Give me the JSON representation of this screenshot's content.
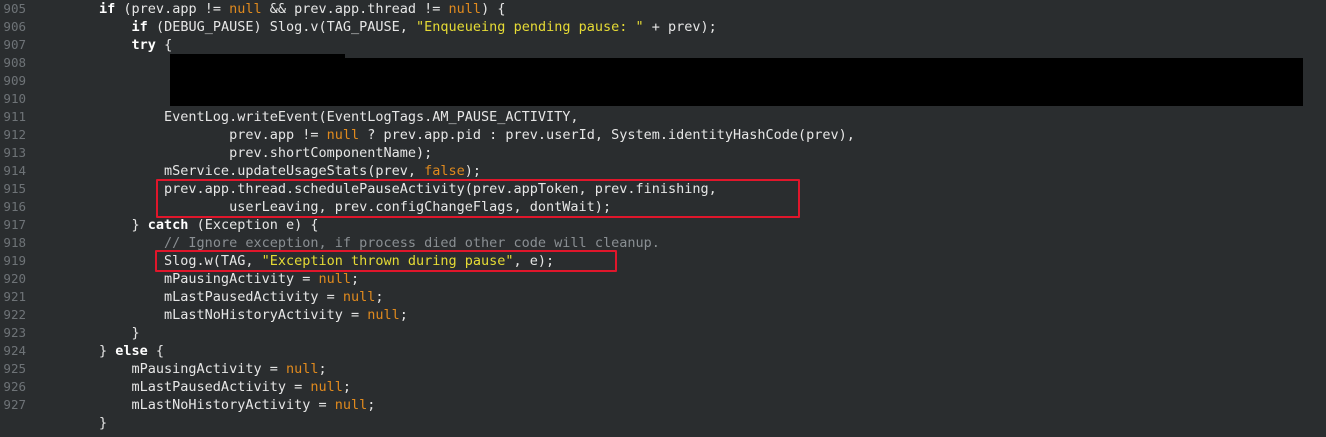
{
  "colors": {
    "background": "#2a2d2f",
    "text": "#e6e6e6",
    "keyword": "#ffffff",
    "literal": "#e08a1e",
    "string": "#e6db35",
    "comment": "#8a8f93",
    "line_number": "#6e7377",
    "highlight_box": "#e0162b",
    "redaction": "#000000"
  },
  "line_numbers": [
    "905",
    "906",
    "907",
    "908",
    "909",
    "910",
    "911",
    "912",
    "913",
    "914",
    "915",
    "916",
    "917",
    "918",
    "919",
    "920",
    "921",
    "922",
    "923",
    "924",
    "925",
    "926",
    "927"
  ],
  "code_lines": [
    [
      {
        "t": "        "
      },
      {
        "t": "if",
        "c": "kw"
      },
      {
        "t": " (prev.app != "
      },
      {
        "t": "null",
        "c": "lit"
      },
      {
        "t": " && prev.app.thread != "
      },
      {
        "t": "null",
        "c": "lit"
      },
      {
        "t": ") {"
      }
    ],
    [
      {
        "t": "            "
      },
      {
        "t": "if",
        "c": "kw"
      },
      {
        "t": " (DEBUG_PAUSE) Slog.v(TAG_PAUSE, "
      },
      {
        "t": "\"Enqueueing pending pause: \"",
        "c": "str"
      },
      {
        "t": " + prev);"
      }
    ],
    [
      {
        "t": "            "
      },
      {
        "t": "try",
        "c": "kw"
      },
      {
        "t": " {"
      }
    ],
    [
      {
        "t": ""
      }
    ],
    [
      {
        "t": ""
      }
    ],
    [
      {
        "t": ""
      }
    ],
    [
      {
        "t": "                EventLog.writeEvent(EventLogTags.AM_PAUSE_ACTIVITY,"
      }
    ],
    [
      {
        "t": "                        prev.app != "
      },
      {
        "t": "null",
        "c": "lit"
      },
      {
        "t": " ? prev.app.pid : prev.userId, System.identityHashCode(prev),"
      }
    ],
    [
      {
        "t": "                        prev.shortComponentName);"
      }
    ],
    [
      {
        "t": "                mService.updateUsageStats(prev, "
      },
      {
        "t": "false",
        "c": "lit"
      },
      {
        "t": ");"
      }
    ],
    [
      {
        "t": "                prev.app.thread.schedulePauseActivity(prev.appToken, prev.finishing,"
      }
    ],
    [
      {
        "t": "                        userLeaving, prev.configChangeFlags, dontWait);"
      }
    ],
    [
      {
        "t": "            } "
      },
      {
        "t": "catch",
        "c": "kw"
      },
      {
        "t": " (Exception e) {"
      }
    ],
    [
      {
        "t": "                "
      },
      {
        "t": "// Ignore exception, if process died other code will cleanup.",
        "c": "cm"
      }
    ],
    [
      {
        "t": "                Slog.w(TAG, "
      },
      {
        "t": "\"Exception thrown during pause\"",
        "c": "str"
      },
      {
        "t": ", e);"
      }
    ],
    [
      {
        "t": "                mPausingActivity = "
      },
      {
        "t": "null",
        "c": "lit"
      },
      {
        "t": ";"
      }
    ],
    [
      {
        "t": "                mLastPausedActivity = "
      },
      {
        "t": "null",
        "c": "lit"
      },
      {
        "t": ";"
      }
    ],
    [
      {
        "t": "                mLastNoHistoryActivity = "
      },
      {
        "t": "null",
        "c": "lit"
      },
      {
        "t": ";"
      }
    ],
    [
      {
        "t": "            }"
      }
    ],
    [
      {
        "t": "        } "
      },
      {
        "t": "else",
        "c": "kw"
      },
      {
        "t": " {"
      }
    ],
    [
      {
        "t": "            mPausingActivity = "
      },
      {
        "t": "null",
        "c": "lit"
      },
      {
        "t": ";"
      }
    ],
    [
      {
        "t": "            mLastPausedActivity = "
      },
      {
        "t": "null",
        "c": "lit"
      },
      {
        "t": ";"
      }
    ],
    [
      {
        "t": "            mLastNoHistoryActivity = "
      },
      {
        "t": "null",
        "c": "lit"
      },
      {
        "t": ";"
      }
    ],
    [
      {
        "t": "        }"
      }
    ]
  ]
}
